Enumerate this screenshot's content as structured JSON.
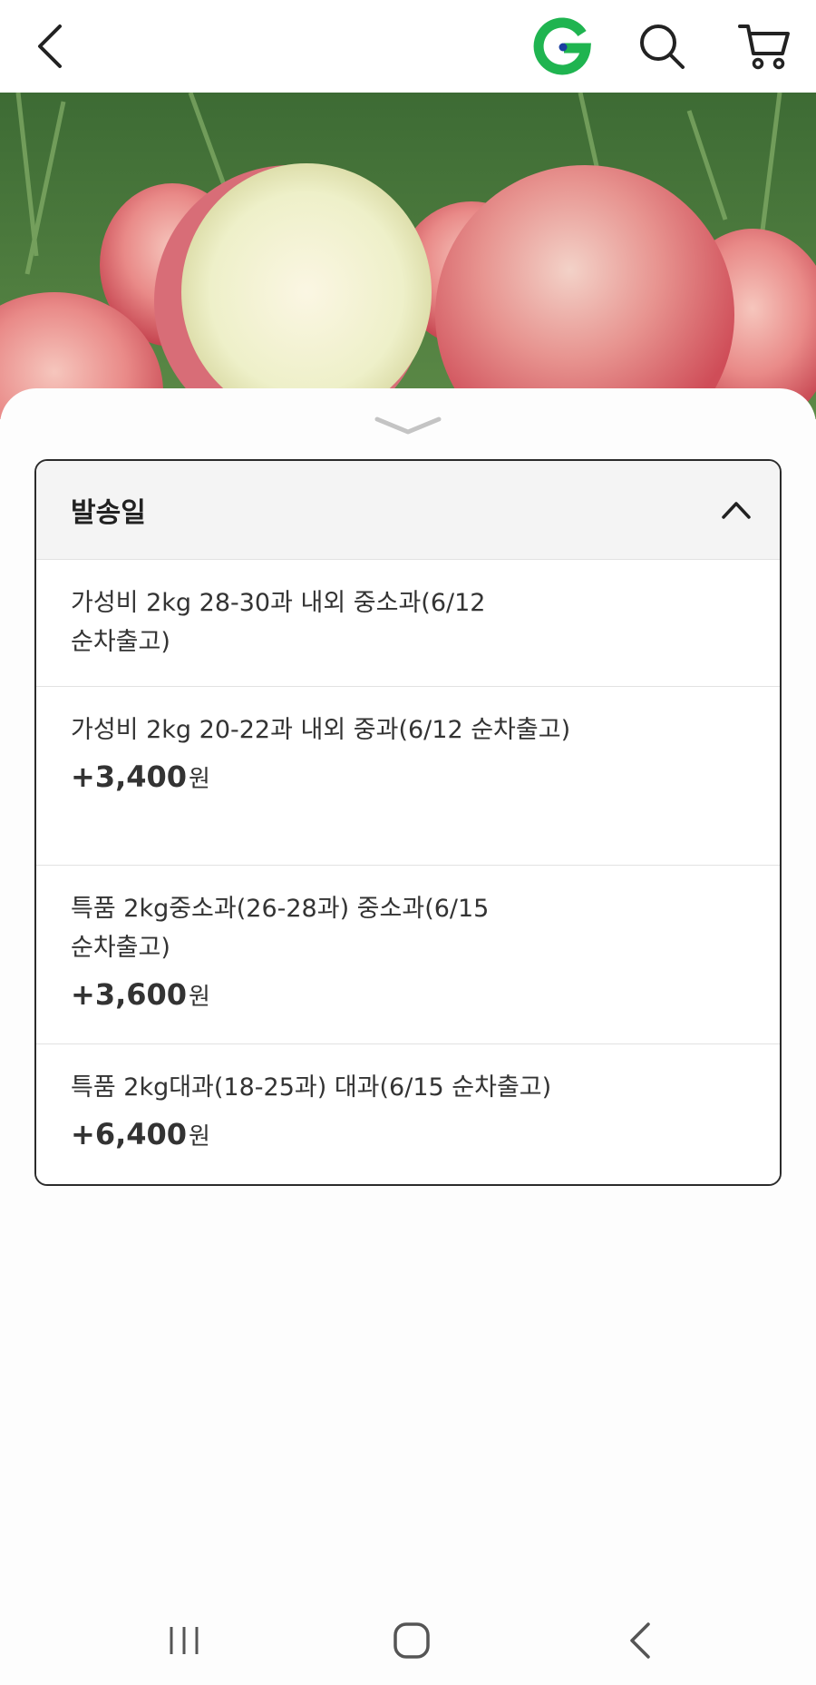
{
  "topbar": {
    "back_icon": "chevron-left-icon",
    "logo_letter": "G",
    "logo_color": "#22b14c",
    "search_icon": "search-icon",
    "cart_icon": "cart-icon"
  },
  "sheet": {
    "handle_icon": "chevron-down-icon",
    "options": {
      "title": "발송일",
      "collapse_icon": "chevron-up-icon",
      "items": [
        {
          "name": "가성비 2kg 28-30과 내외 중소과(6/12 순차출고)",
          "price": "",
          "currency": ""
        },
        {
          "name": "가성비 2kg 20-22과 내외 중과(6/12 순차출고)",
          "price": "+3,400",
          "currency": "원"
        },
        {
          "name": "특품 2kg중소과(26-28과) 중소과(6/15 순차출고)",
          "price": "+3,600",
          "currency": "원"
        },
        {
          "name": "특품 2kg대과(18-25과) 대과(6/15 순차출고)",
          "price": "+6,400",
          "currency": "원"
        }
      ]
    }
  },
  "navbar": {
    "recents_icon": "recents-icon",
    "home_icon": "home-icon",
    "back_icon": "back-icon"
  }
}
